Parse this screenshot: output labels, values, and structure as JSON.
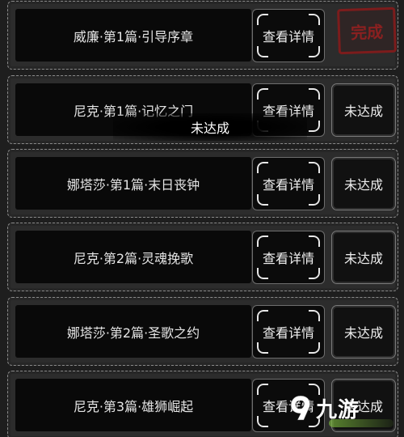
{
  "rows": [
    {
      "chapter": "威廉·第1篇·引导序章",
      "details_label": "查看详情",
      "status": "完成",
      "completed": true
    },
    {
      "chapter": "尼克·第1篇·记忆之门",
      "details_label": "查看详情",
      "status": "未达成",
      "completed": false
    },
    {
      "chapter": "娜塔莎·第1篇·末日丧钟",
      "details_label": "查看详情",
      "status": "未达成",
      "completed": false
    },
    {
      "chapter": "尼克·第2篇·灵魂挽歌",
      "details_label": "查看详情",
      "status": "未达成",
      "completed": false
    },
    {
      "chapter": "娜塔莎·第2篇·圣歌之约",
      "details_label": "查看详情",
      "status": "未达成",
      "completed": false
    },
    {
      "chapter": "尼克·第3篇·雄狮崛起",
      "details_label": "查看详情",
      "status": "未达成",
      "completed": false
    }
  ],
  "toast": {
    "text": "未达成"
  },
  "watermark": {
    "text": "九游"
  },
  "colors": {
    "stamp_red": "#9b1f1f",
    "panel_bg": "#2c2c2c",
    "text": "#e6e6e6"
  }
}
